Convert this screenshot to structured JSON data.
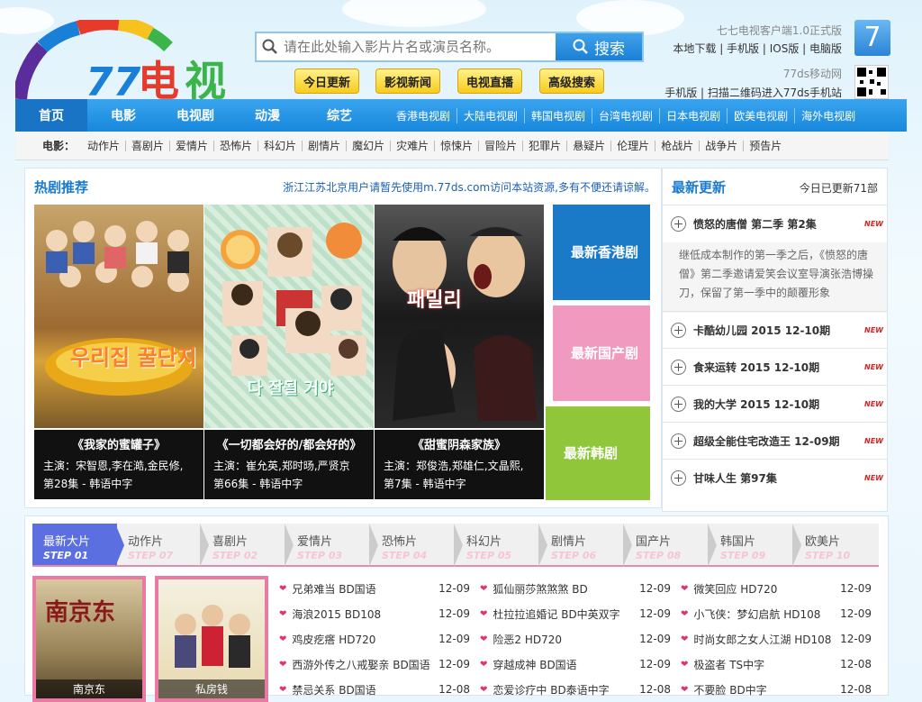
{
  "header": {
    "logo_text": "77电视",
    "search_placeholder": "请在此处输入影片片名或演员名称。",
    "search_button": "搜索",
    "quick_links": [
      "今日更新",
      "影视新闻",
      "电视直播",
      "高级搜索"
    ],
    "client_title": "七七电视客户端1.0正式版",
    "client_links": "本地下载 | 手机版 | IOS版 | 电脑版",
    "mobile_title": "77ds移动网",
    "mobile_text": "手机版 | 扫描二维码进入77ds手机站",
    "app_icon": "7"
  },
  "nav": {
    "main": [
      "首页",
      "电影",
      "电视剧",
      "动漫",
      "综艺"
    ],
    "sub": [
      "香港电视剧",
      "大陆电视剧",
      "韩国电视剧",
      "台湾电视剧",
      "日本电视剧",
      "欧美电视剧",
      "海外电视剧"
    ]
  },
  "cats": {
    "label": "电影：",
    "items": [
      "动作片",
      "喜剧片",
      "爱情片",
      "恐怖片",
      "科幻片",
      "剧情片",
      "魔幻片",
      "灾难片",
      "惊悚片",
      "冒险片",
      "犯罪片",
      "悬疑片",
      "伦理片",
      "枪战片",
      "战争片",
      "预告片"
    ]
  },
  "hot": {
    "title": "热剧推荐",
    "notice": "浙江江苏北京用户请暂先使用m.77ds.com访问本站资源,多有不便还请谅解。",
    "cards": [
      {
        "title": "《我家的蜜罐子》",
        "cast": "主演：宋智恩,李在澔,金民修,",
        "info": "第28集 - 韩语中字",
        "poster_text": "우리집 꿀단지"
      },
      {
        "title": "《一切都会好的/都会好的》",
        "cast": "主演：崔允英,郑时旸,严贤京",
        "info": "第66集 - 韩语中字",
        "poster_text": "다 잘될 거야"
      },
      {
        "title": "《甜蜜阴森家族》",
        "cast": "主演：郑俊浩,郑雄仁,文晶熙,",
        "info": "第7集 - 韩语中字",
        "poster_text": "패밀리"
      }
    ],
    "tiles": [
      "最新香港剧",
      "最新国产剧",
      "最新韩剧"
    ]
  },
  "latest": {
    "title": "最新更新",
    "count": "今日已更新71部",
    "new_badge": "NEW",
    "first": "愤怒的唐僧 第二季 第2集",
    "desc": "继低成本制作的第一季之后，《愤怒的唐僧》第二季邀请爱笑会议室导演张浩博操刀，保留了第一季中的颠覆形象",
    "items": [
      "卡酷幼儿园 2015 12-10期",
      "食来运转 2015 12-10期",
      "我的大学 2015 12-10期",
      "超级全能住宅改造王 12-09期",
      "甘味人生 第97集"
    ]
  },
  "films": {
    "steps": [
      {
        "name": "最新大片",
        "step": "STEP 01"
      },
      {
        "name": "动作片",
        "step": "STEP 07"
      },
      {
        "name": "喜剧片",
        "step": "STEP 02"
      },
      {
        "name": "爱情片",
        "step": "STEP 03"
      },
      {
        "name": "恐怖片",
        "step": "STEP 04"
      },
      {
        "name": "科幻片",
        "step": "STEP 05"
      },
      {
        "name": "剧情片",
        "step": "STEP 06"
      },
      {
        "name": "国产片",
        "step": "STEP 08"
      },
      {
        "name": "韩国片",
        "step": "STEP 09"
      },
      {
        "name": "欧美片",
        "step": "STEP 10"
      }
    ],
    "posters": [
      "南京东",
      "私房钱"
    ],
    "col1": [
      [
        "兄弟难当 BD国语",
        "12-09"
      ],
      [
        "海浪2015 BD108",
        "12-09"
      ],
      [
        "鸡皮疙瘩 HD720",
        "12-09"
      ],
      [
        "西游外传之八戒娶亲 BD国语",
        "12-09"
      ],
      [
        "禁忌关系 BD国语",
        "12-08"
      ]
    ],
    "col2": [
      [
        "狐仙丽莎煞煞煞 BD",
        "12-09"
      ],
      [
        "杜拉拉追婚记 BD中英双字",
        "12-09"
      ],
      [
        "险恶2 HD720",
        "12-09"
      ],
      [
        "穿越成神 BD国语",
        "12-09"
      ],
      [
        "恋爱诊疗中 BD泰语中字",
        "12-08"
      ]
    ],
    "col3": [
      [
        "微笑回应 HD720",
        "12-09"
      ],
      [
        "小飞侠：梦幻启航 HD108",
        "12-09"
      ],
      [
        "时尚女郎之女人江湖 HD108",
        "12-09"
      ],
      [
        "极盗者 TS中字",
        "12-08"
      ],
      [
        "不要脸 BD中字",
        "12-08"
      ]
    ]
  }
}
